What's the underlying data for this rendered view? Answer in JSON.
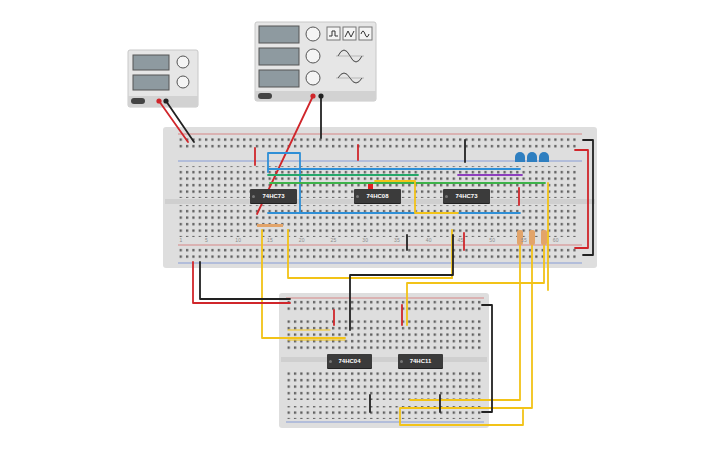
{
  "breadboards": [
    {
      "column_numbers": [
        "1",
        "5",
        "10",
        "15",
        "20",
        "25",
        "30",
        "35",
        "40",
        "45",
        "50",
        "55",
        "60"
      ]
    }
  ],
  "chips": [
    {
      "label": "74HC73"
    },
    {
      "label": "74HC08"
    },
    {
      "label": "74HC73"
    },
    {
      "label": "74HC04"
    },
    {
      "label": "74HC11"
    }
  ]
}
